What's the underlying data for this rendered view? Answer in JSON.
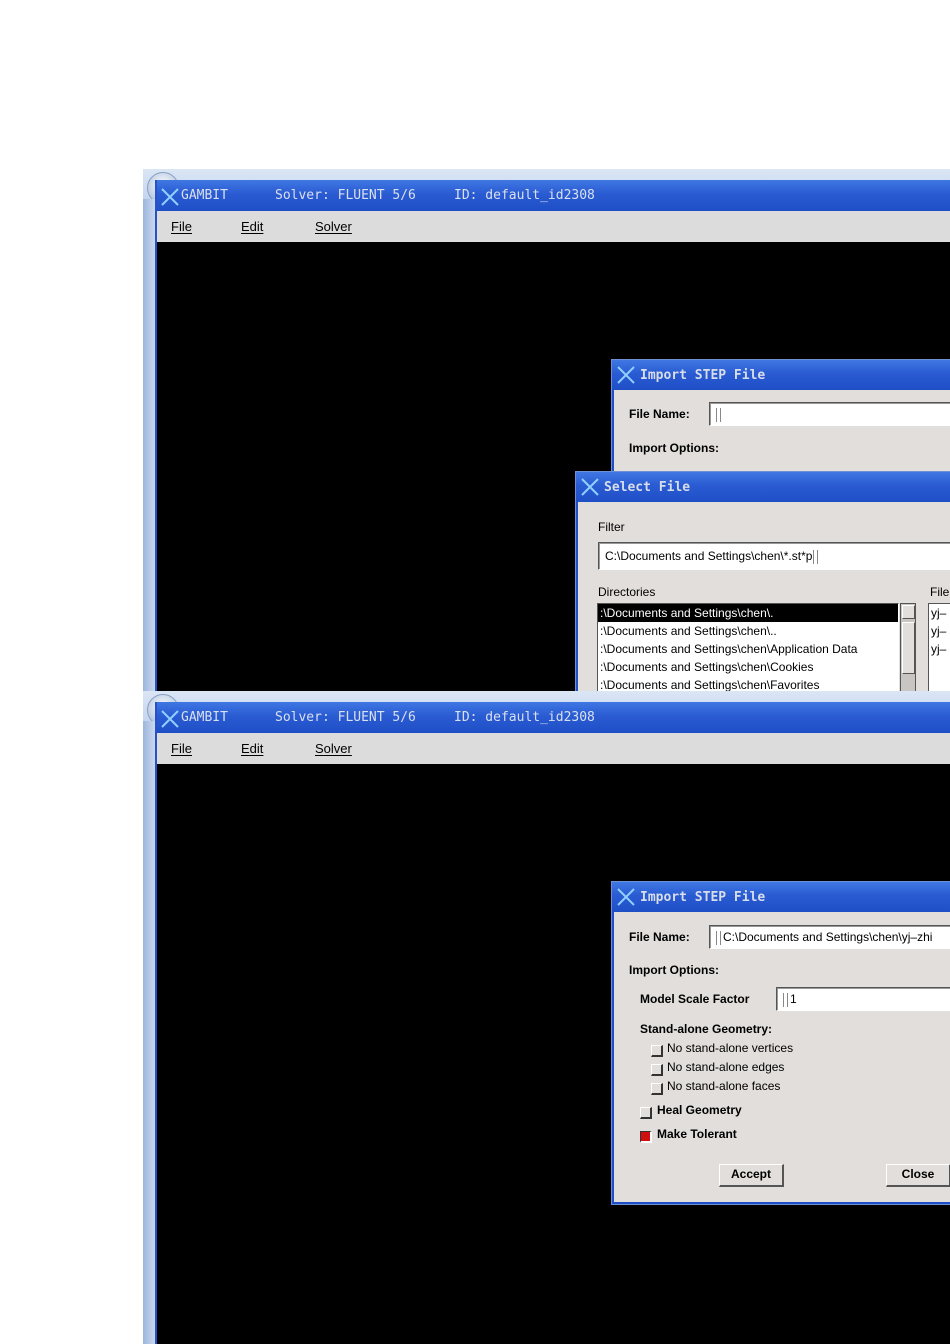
{
  "gambit": {
    "app_name": "GAMBIT",
    "solver_text": "Solver: FLUENT 5/6",
    "id_text": "ID: default_id2308",
    "menu": {
      "file": "File",
      "edit": "Edit",
      "solver": "Solver"
    }
  },
  "import_dialog_1": {
    "title": "Import STEP File",
    "file_name_label": "File Name:",
    "file_name_value": "",
    "import_options_label": "Import Options:"
  },
  "select_file_dialog": {
    "title": "Select File",
    "filter_label": "Filter",
    "filter_value": "C:\\Documents and Settings\\chen\\*.st*p",
    "directories_label": "Directories",
    "files_label": "File",
    "directories": [
      ":\\Documents and Settings\\chen\\.",
      ":\\Documents and Settings\\chen\\..",
      ":\\Documents and Settings\\chen\\Application Data",
      ":\\Documents and Settings\\chen\\Cookies",
      ":\\Documents and Settings\\chen\\Favorites"
    ],
    "files": [
      "yj–",
      "yj–",
      "yj–"
    ]
  },
  "import_dialog_2": {
    "title": "Import STEP File",
    "file_name_label": "File Name:",
    "file_name_value": "C:\\Documents and Settings\\chen\\yj–zhi",
    "import_options_label": "Import Options:",
    "model_scale_label": "Model Scale Factor",
    "model_scale_value": "1",
    "standalone_label": "Stand-alone Geometry:",
    "no_vertices": "No stand-alone vertices",
    "no_edges": "No stand-alone edges",
    "no_faces": "No stand-alone faces",
    "heal_geometry": "Heal Geometry",
    "make_tolerant": "Make Tolerant",
    "make_tolerant_checked": true,
    "accept_label": "Accept",
    "close_label": "Close"
  }
}
